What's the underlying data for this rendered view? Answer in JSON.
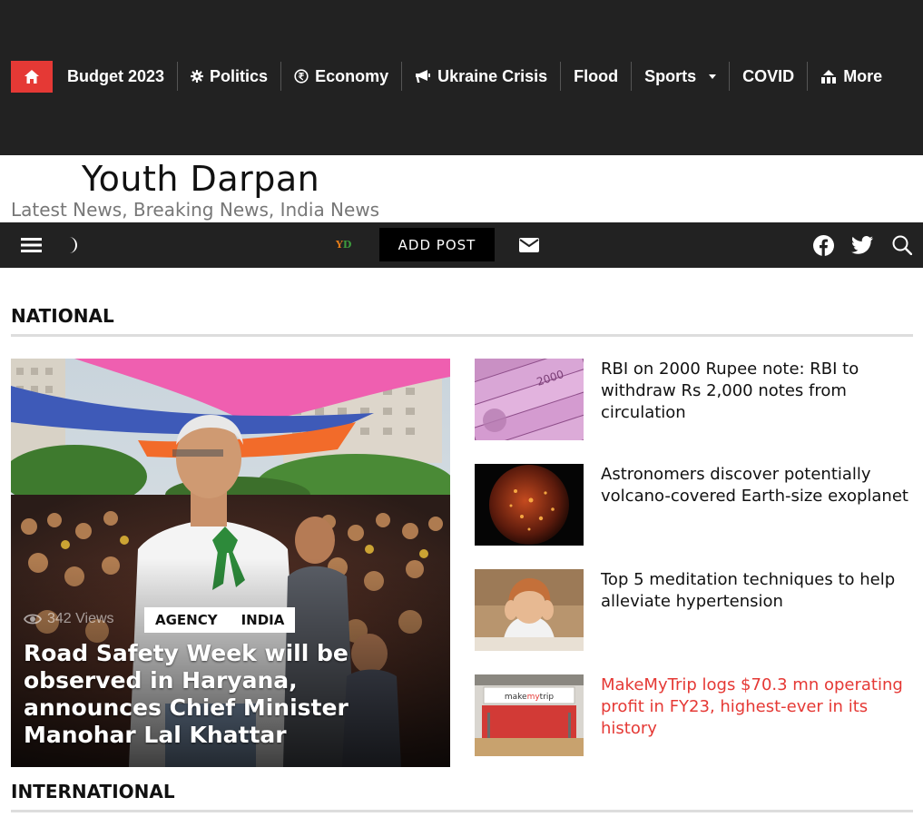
{
  "topnav": {
    "items": [
      {
        "label": "Budget 2023",
        "icon": "none"
      },
      {
        "label": "Politics",
        "icon": "gear-icon"
      },
      {
        "label": "Economy",
        "icon": "rupee-coin-icon"
      },
      {
        "label": "Ukraine Crisis",
        "icon": "megaphone-icon"
      },
      {
        "label": "Flood",
        "icon": "none"
      },
      {
        "label": "Sports",
        "icon": "chevron-down-icon"
      },
      {
        "label": "COVID",
        "icon": "none"
      },
      {
        "label": "More",
        "icon": "sitemap-icon"
      }
    ],
    "accent": "#e53935",
    "bg": "#222222"
  },
  "masthead": {
    "title": "Youth Darpan",
    "tagline": "Latest News, Breaking News, India News"
  },
  "utilbar": {
    "logo_y": "Y",
    "logo_d": "D",
    "add_post": "ADD POST"
  },
  "sections": {
    "national": "NATIONAL",
    "international": "INTERNATIONAL"
  },
  "featured": {
    "views": "342 Views",
    "tags": [
      "AGENCY",
      "INDIA"
    ],
    "title": "Road Safety Week will be observed in Haryana, announces Chief Minister Manohar Lal Khattar"
  },
  "stories": [
    {
      "headline": "RBI on 2000 Rupee note: RBI to withdraw Rs 2,000 notes from circulation"
    },
    {
      "headline": "Astronomers discover potentially volcano-covered Earth-size exoplanet"
    },
    {
      "headline": "Top 5 meditation techniques to help alleviate hypertension"
    },
    {
      "headline": "MakeMyTrip logs $70.3 mn operating profit in FY23, highest-ever in its history",
      "highlight": "#e53935"
    }
  ]
}
